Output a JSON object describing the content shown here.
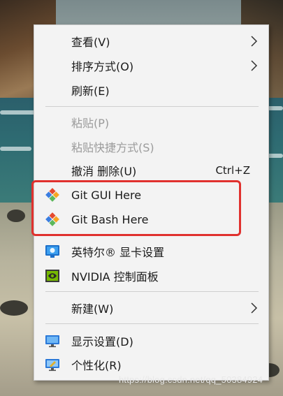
{
  "menu": {
    "items": [
      {
        "label": "查看(V)",
        "submenu": true
      },
      {
        "label": "排序方式(O)",
        "submenu": true
      },
      {
        "label": "刷新(E)"
      },
      {
        "label": "粘贴(P)",
        "disabled": true
      },
      {
        "label": "粘贴快捷方式(S)",
        "disabled": true
      },
      {
        "label": "撤消 删除(U)",
        "shortcut": "Ctrl+Z"
      },
      {
        "label": "Git GUI Here",
        "icon": "git-icon"
      },
      {
        "label": "Git Bash Here",
        "icon": "git-icon"
      },
      {
        "label": "英特尔® 显卡设置",
        "icon": "intel-graphics-icon"
      },
      {
        "label": "NVIDIA 控制面板",
        "icon": "nvidia-icon"
      },
      {
        "label": "新建(W)",
        "submenu": true
      },
      {
        "label": "显示设置(D)",
        "icon": "display-settings-icon"
      },
      {
        "label": "个性化(R)",
        "icon": "personalize-icon"
      }
    ]
  },
  "watermark": "https://blog.csdn.net/qq_50384924",
  "colors": {
    "highlight": "#e0312e",
    "menu_bg": "#f3f3f3",
    "disabled_text": "#9b9b9b"
  }
}
